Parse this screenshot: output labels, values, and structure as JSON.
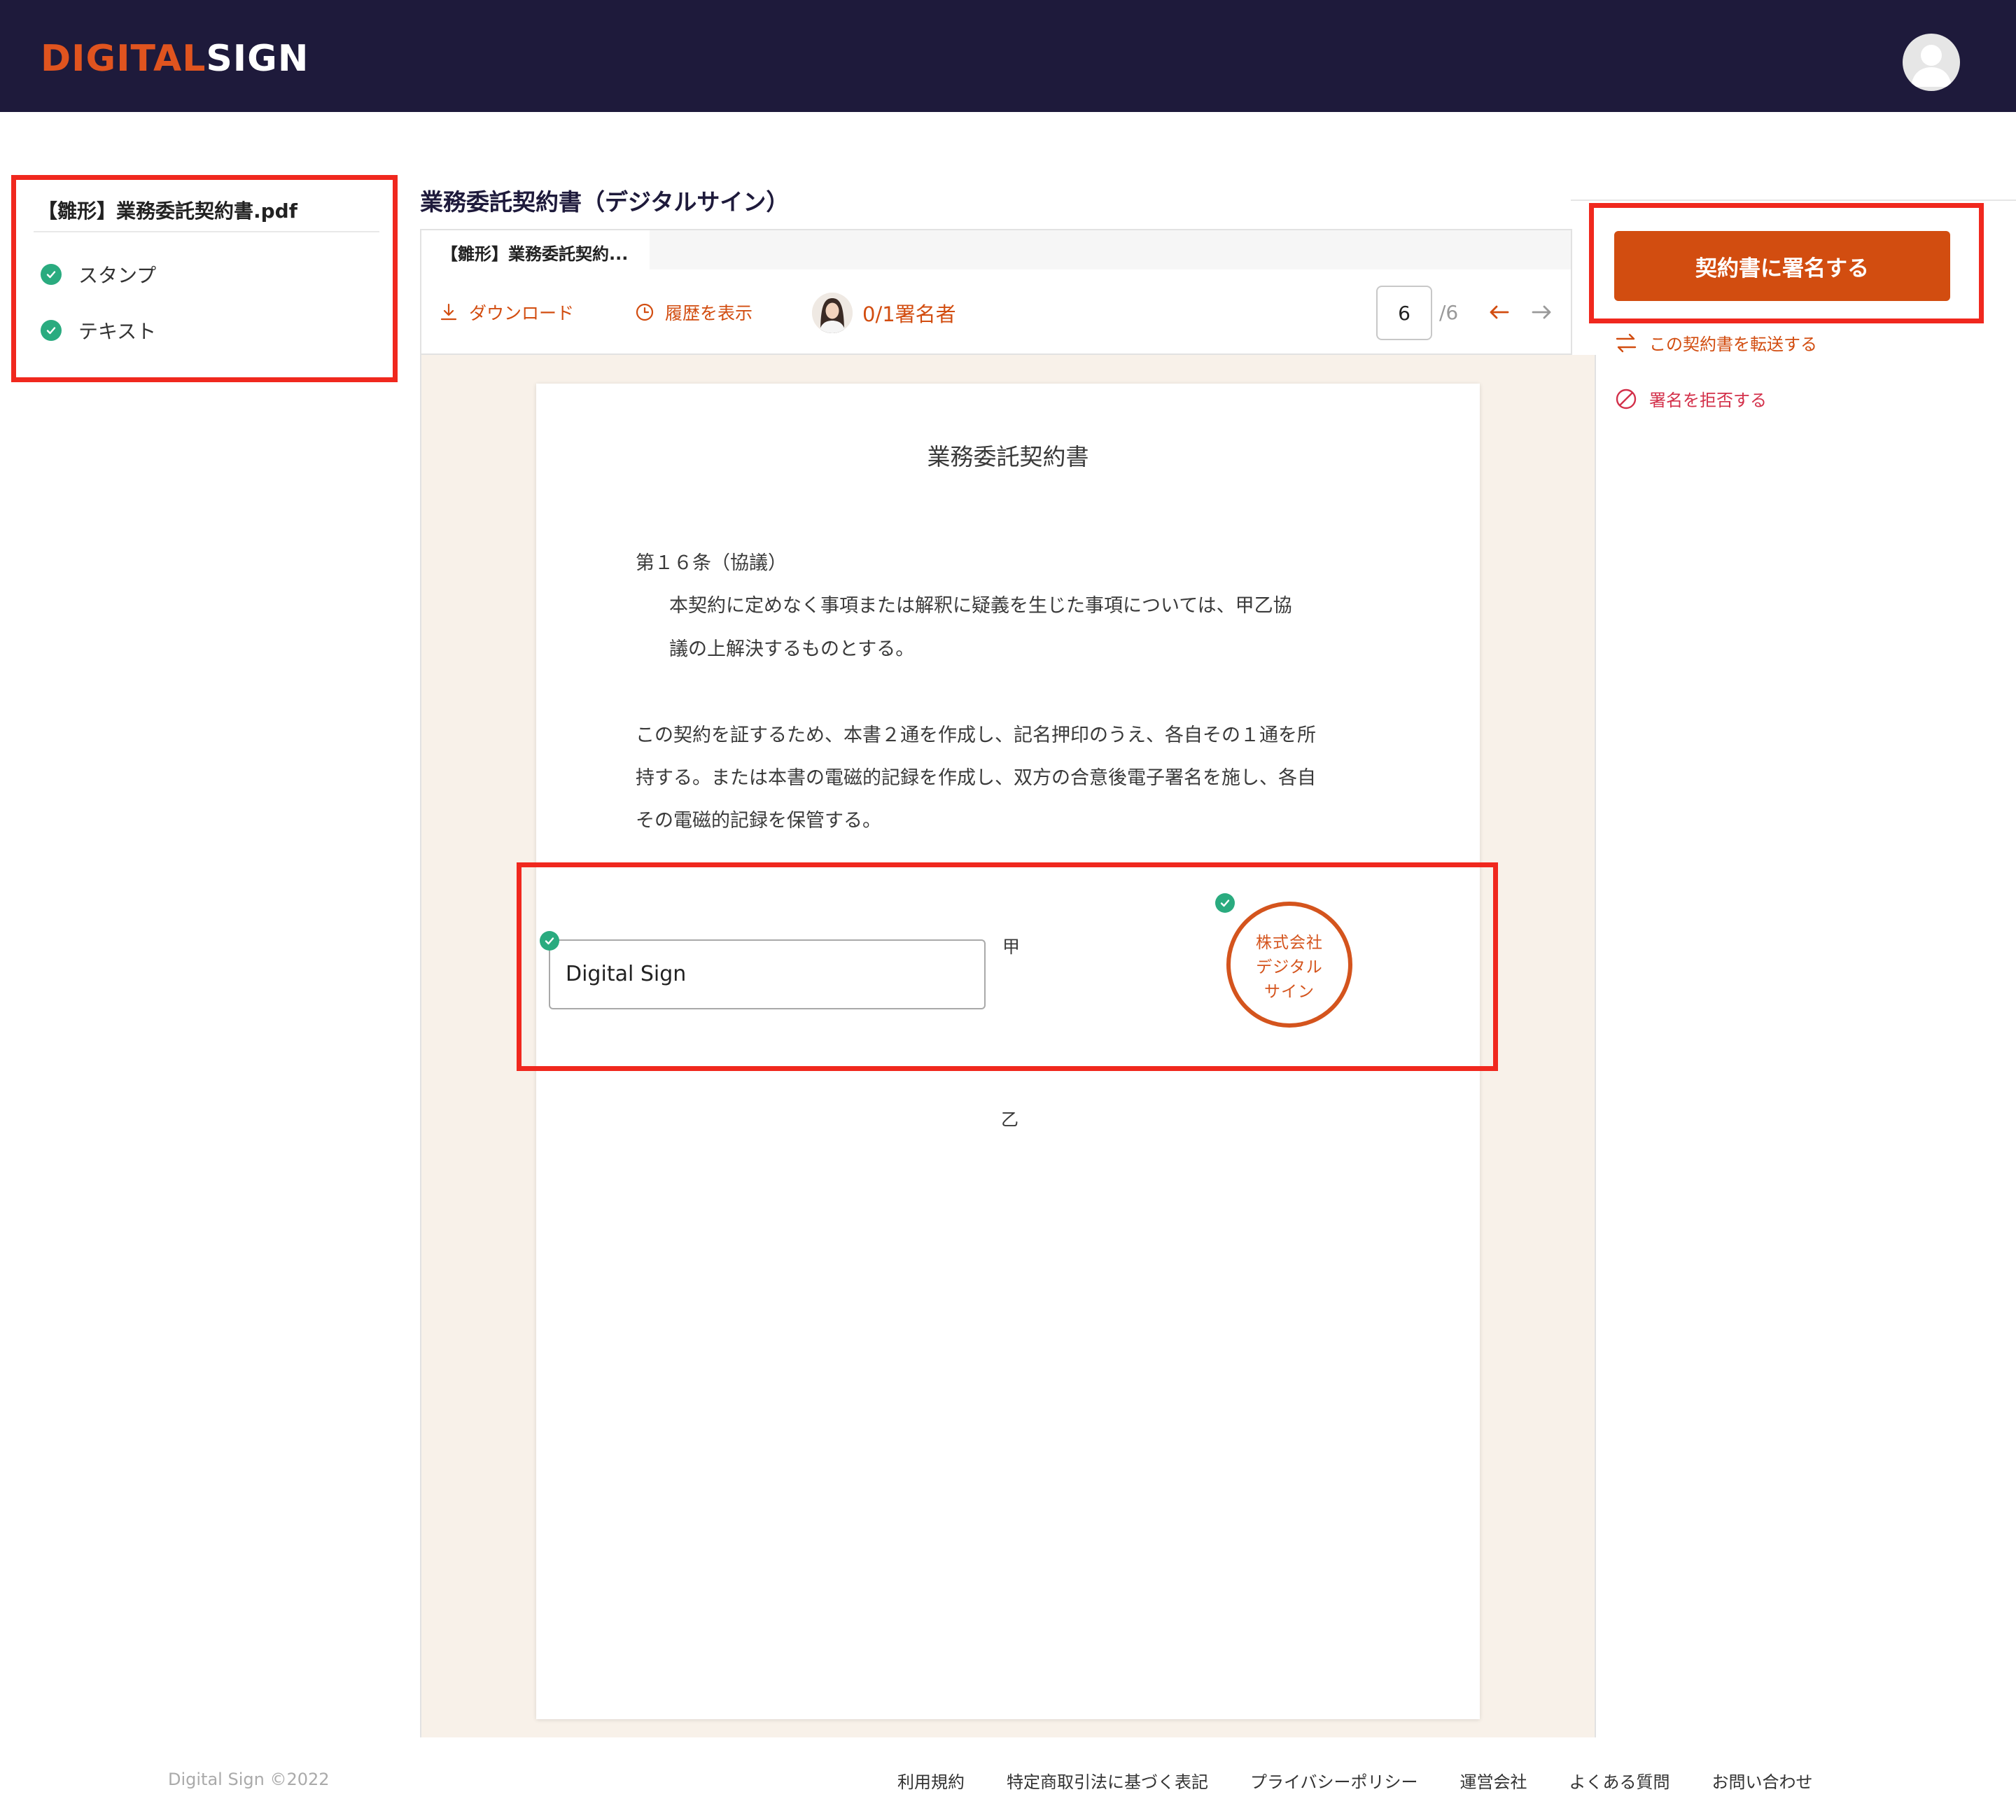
{
  "header": {
    "logo_part1": "DIGITAL",
    "logo_part2": "SIGN"
  },
  "left_panel": {
    "file_name": "【雛形】業務委託契約書.pdf",
    "items": [
      {
        "label": "スタンプ"
      },
      {
        "label": "テキスト"
      }
    ]
  },
  "document": {
    "title": "業務委託契約書（デジタルサイン）",
    "tab_label": "【雛形】業務委託契約...",
    "toolbar": {
      "download": "ダウンロード",
      "history": "履歴を表示",
      "signers": "0/1署名者",
      "current_page": "6",
      "total_pages": "/6"
    },
    "pdf": {
      "heading": "業務委託契約書",
      "article_title": "第１６条（協議）",
      "article_line1": "本契約に定めなく事項または解釈に疑義を生じた事項については、甲乙協",
      "article_line2": "議の上解決するものとする。",
      "closing_line1": "この契約を証するため、本書２通を作成し、記名押印のうえ、各自その１通を所",
      "closing_line2": "持する。または本書の電磁的記録を作成し、双方の合意後電子署名を施し、各自",
      "closing_line3": "その電磁的記録を保管する。",
      "party_a": "甲",
      "party_b": "乙",
      "text_field_value": "Digital Sign",
      "seal_line1": "株式会社",
      "seal_line2": "デジタル",
      "seal_line3": "サイン"
    }
  },
  "right_panel": {
    "sign_button": "契約書に署名する",
    "transfer_link": "この契約書を転送する",
    "reject_link": "署名を拒否する"
  },
  "footer": {
    "copyright": "Digital Sign ©2022",
    "links": [
      "利用規約",
      "特定商取引法に基づく表記",
      "プライバシーポリシー",
      "運営会社",
      "よくある質問",
      "お問い合わせ"
    ]
  },
  "colors": {
    "header_bg": "#1e1a3b",
    "accent": "#d24d10",
    "success": "#2aab7f",
    "highlight": "#f0281e",
    "danger": "#d3304a"
  }
}
